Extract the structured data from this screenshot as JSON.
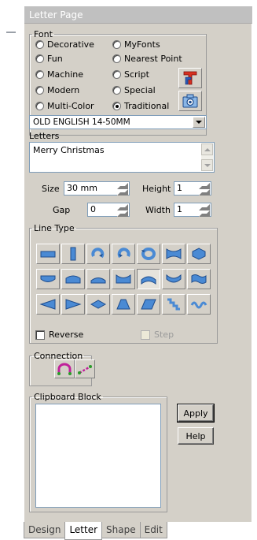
{
  "panel": {
    "title": "Letter Page"
  },
  "font": {
    "legend": "Font",
    "options": [
      {
        "label": "Decorative",
        "checked": false
      },
      {
        "label": "MyFonts",
        "checked": false
      },
      {
        "label": "Fun",
        "checked": false
      },
      {
        "label": "Nearest Point",
        "checked": false
      },
      {
        "label": "Machine",
        "checked": false
      },
      {
        "label": "Script",
        "checked": false
      },
      {
        "label": "Modern",
        "checked": false
      },
      {
        "label": "Special",
        "checked": false
      },
      {
        "label": "Multi-Color",
        "checked": false
      },
      {
        "label": "Traditional",
        "checked": true
      }
    ],
    "selected_font": "OLD ENGLISH 14-50MM",
    "icons": [
      "font-wizard-icon",
      "camera-icon"
    ]
  },
  "letters": {
    "label": "Letters",
    "text": "Merry Christmas"
  },
  "size": {
    "label": "Size",
    "value": "30 mm"
  },
  "height": {
    "label": "Height",
    "value": "1"
  },
  "gap": {
    "label": "Gap",
    "value": "0"
  },
  "width": {
    "label": "Width",
    "value": "1"
  },
  "line_type": {
    "legend": "Line Type",
    "selected_index": 11,
    "icons": [
      "straight-line-icon",
      "vertical-line-icon",
      "circle-clockwise-icon",
      "circle-counterclockwise-icon",
      "circle-both-icon",
      "bowtie-icon",
      "hexagon-icon",
      "arch-down-icon",
      "wave-top-icon",
      "mound-icon",
      "valley-top-icon",
      "arc-up-icon",
      "smile-curve-icon",
      "wavy-banner-icon",
      "taper-left-icon",
      "taper-right-icon",
      "diamond-icon",
      "trapezoid-icon",
      "parallelogram-icon",
      "staircase-icon",
      "wave-line-icon"
    ],
    "reverse_label": "Reverse",
    "step_label": "Step"
  },
  "connection": {
    "legend": "Connection",
    "icons": [
      "arc-connection-icon",
      "line-connection-icon"
    ]
  },
  "clipboard": {
    "legend": "Clipboard Block"
  },
  "buttons": {
    "apply": "Apply",
    "help": "Help"
  },
  "tabs": [
    {
      "label": "Design",
      "active": false
    },
    {
      "label": "Letter",
      "active": true
    },
    {
      "label": "Shape",
      "active": false
    },
    {
      "label": "Edit",
      "active": false
    }
  ],
  "colors": {
    "panel_bg": "#d4d0c8",
    "icon_blue": "#4a8ad4",
    "accent_magenta": "#c0209a",
    "accent_green": "#2a9a2a"
  }
}
